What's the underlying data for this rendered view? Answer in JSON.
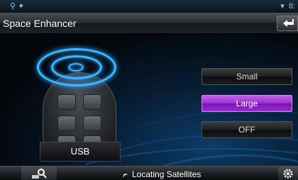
{
  "status_bar": {
    "left_icons": [
      "usb-icon",
      "bluetooth-icon"
    ],
    "right_icons": [
      "wifi-icon"
    ],
    "time_partial": "8:"
  },
  "title_bar": {
    "title": "Space Enhancer",
    "back_icon": "back-return-icon"
  },
  "visual": {
    "source_label": "USB",
    "icon": "car-speaker-icon"
  },
  "options": [
    {
      "label": "Small",
      "selected": false
    },
    {
      "label": "Large",
      "selected": true
    },
    {
      "label": "OFF",
      "selected": false
    }
  ],
  "bottom_bar": {
    "left_icon": "search-icon",
    "nav_status": "Locating Satellites",
    "nav_icon": "satellite-icon",
    "right_icon": "gear-icon"
  },
  "colors": {
    "accent_selected": "#9a2fd0",
    "ring_blue": "#3fb6ff"
  }
}
